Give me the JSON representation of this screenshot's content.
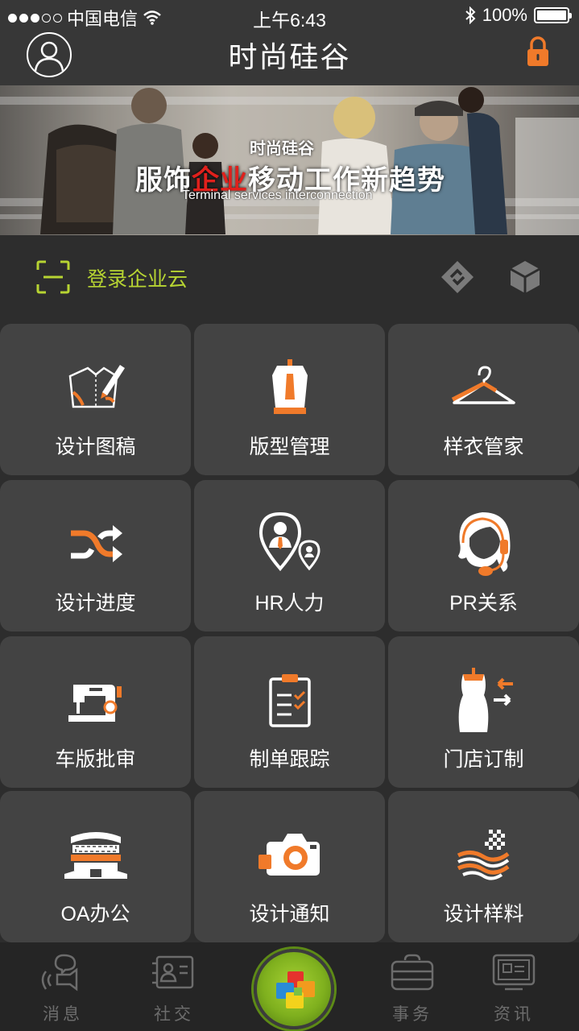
{
  "status_bar": {
    "carrier": "中国电信",
    "time": "上午6:43",
    "battery": "100%"
  },
  "header": {
    "title": "时尚硅谷",
    "avatar_icon": "user-avatar-icon",
    "lock_icon": "lock-icon",
    "lock_color": "#f07a2a"
  },
  "banner": {
    "small_title": "时尚硅谷",
    "headline_pre": "服饰",
    "headline_red": "企业",
    "headline_post": "移动工作新趋势",
    "subtitle": "Terminal services interconnection"
  },
  "login": {
    "label": "登录企业云",
    "accent": "#b7d432"
  },
  "grid": {
    "tiles": [
      {
        "label": "设计图稿",
        "icon": "design-sketch-icon"
      },
      {
        "label": "版型管理",
        "icon": "pattern-lamp-icon"
      },
      {
        "label": "样衣管家",
        "icon": "hanger-icon"
      },
      {
        "label": "设计进度",
        "icon": "shuffle-icon"
      },
      {
        "label": "HR人力",
        "icon": "location-person-icon"
      },
      {
        "label": "PR关系",
        "icon": "headset-person-icon"
      },
      {
        "label": "车版批审",
        "icon": "sewing-machine-icon"
      },
      {
        "label": "制单跟踪",
        "icon": "clipboard-check-icon"
      },
      {
        "label": "门店订制",
        "icon": "mannequin-icon"
      },
      {
        "label": "OA办公",
        "icon": "office-building-icon"
      },
      {
        "label": "设计通知",
        "icon": "camera-icon"
      },
      {
        "label": "设计样料",
        "icon": "fabric-swatch-icon"
      }
    ]
  },
  "tabbar": {
    "items": [
      {
        "label": "消息",
        "icon": "message-megaphone-icon"
      },
      {
        "label": "社交",
        "icon": "contact-card-icon"
      },
      {
        "label": "事务",
        "icon": "briefcase-icon"
      },
      {
        "label": "资讯",
        "icon": "news-screen-icon"
      }
    ],
    "center_icon": "app-cubes-icon"
  },
  "colors": {
    "accent_orange": "#f07a2a",
    "tile_bg": "#434343",
    "page_bg": "#2d2d2d"
  }
}
